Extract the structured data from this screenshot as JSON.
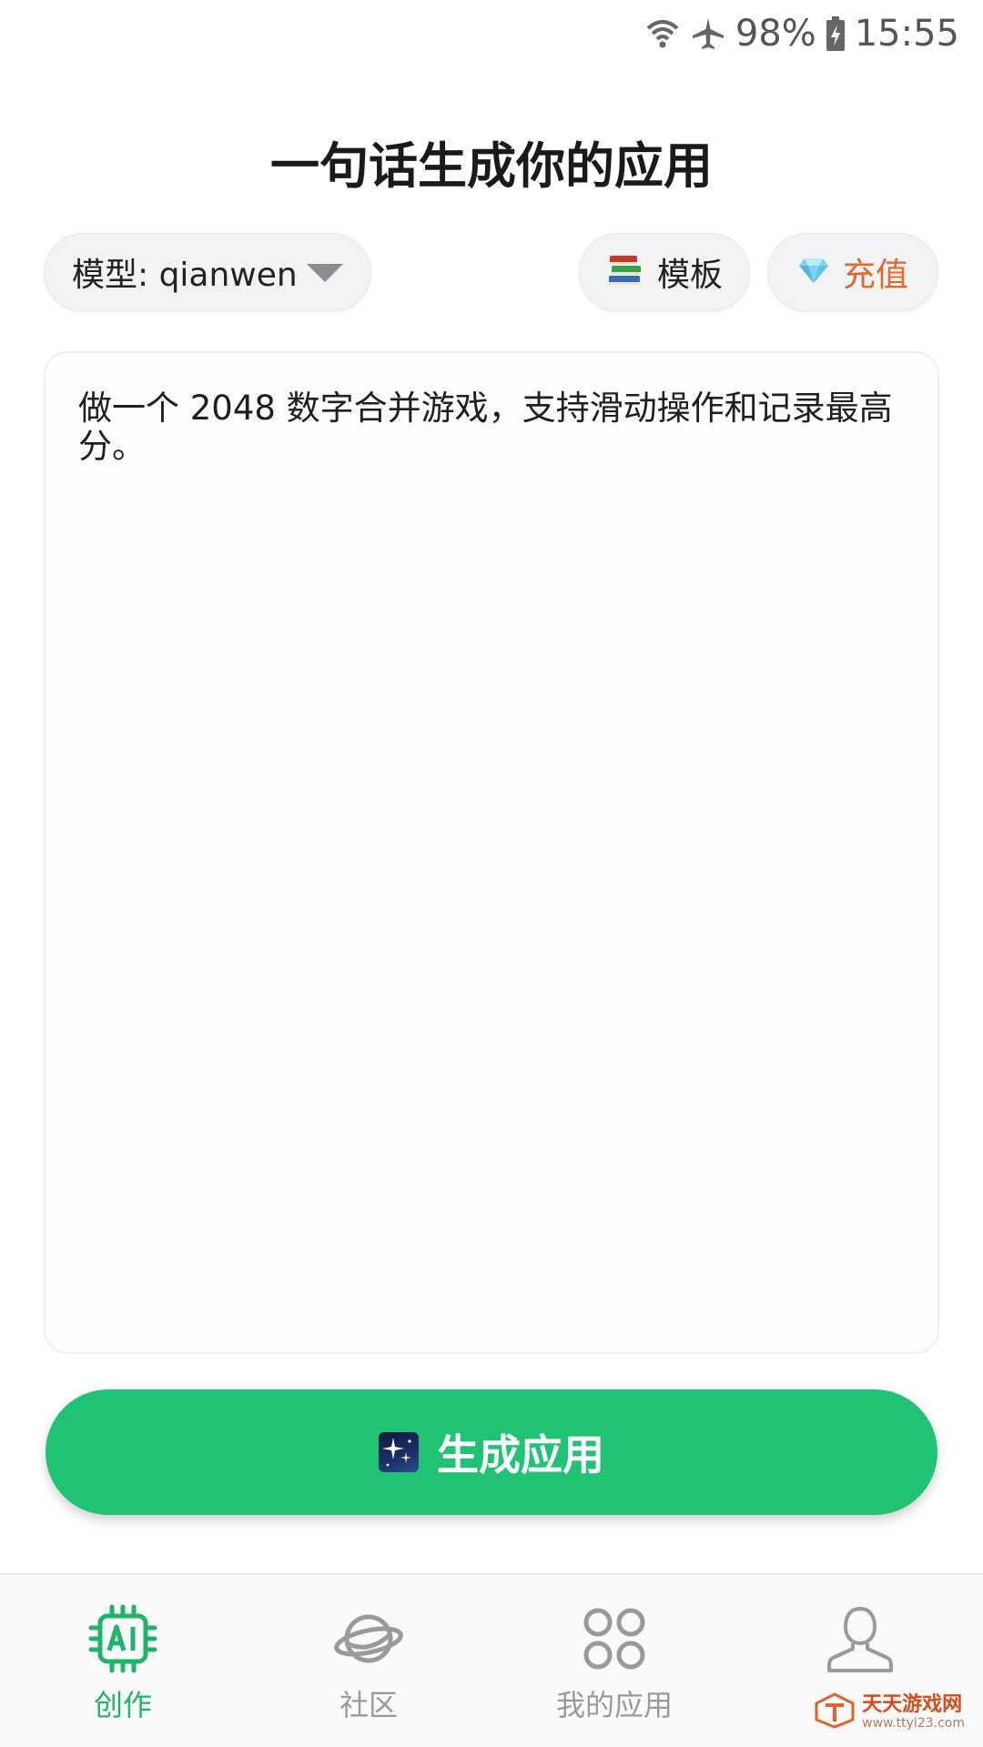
{
  "status_bar": {
    "battery": "98%",
    "time": "15:55",
    "icons": [
      "wifi-icon",
      "airplane-icon",
      "battery-icon"
    ]
  },
  "header": {
    "title": "一句话生成你的应用"
  },
  "model_selector": {
    "label": "模型: qianwen"
  },
  "toolbar": {
    "template_label": "模板",
    "template_icon": "books-icon",
    "recharge_label": "充值",
    "recharge_icon": "diamond-icon"
  },
  "prompt": {
    "value": "做一个 2048 数字合并游戏，支持滑动操作和记录最高分。"
  },
  "generate": {
    "label": "生成应用",
    "icon": "sparkle-icon"
  },
  "bottom_nav": {
    "items": [
      {
        "label": "创作",
        "icon": "ai-chip-icon",
        "active": true
      },
      {
        "label": "社区",
        "icon": "planet-icon",
        "active": false
      },
      {
        "label": "我的应用",
        "icon": "apps-grid-icon",
        "active": false
      },
      {
        "label": "",
        "icon": "user-icon",
        "active": false
      }
    ]
  },
  "watermark": {
    "main": "天天游戏网",
    "sub": "www.ttyl23.com"
  },
  "colors": {
    "accent": "#20c373",
    "recharge": "#e4682a",
    "nav_active": "#20b46a",
    "nav_inactive": "#9a9a9a"
  }
}
